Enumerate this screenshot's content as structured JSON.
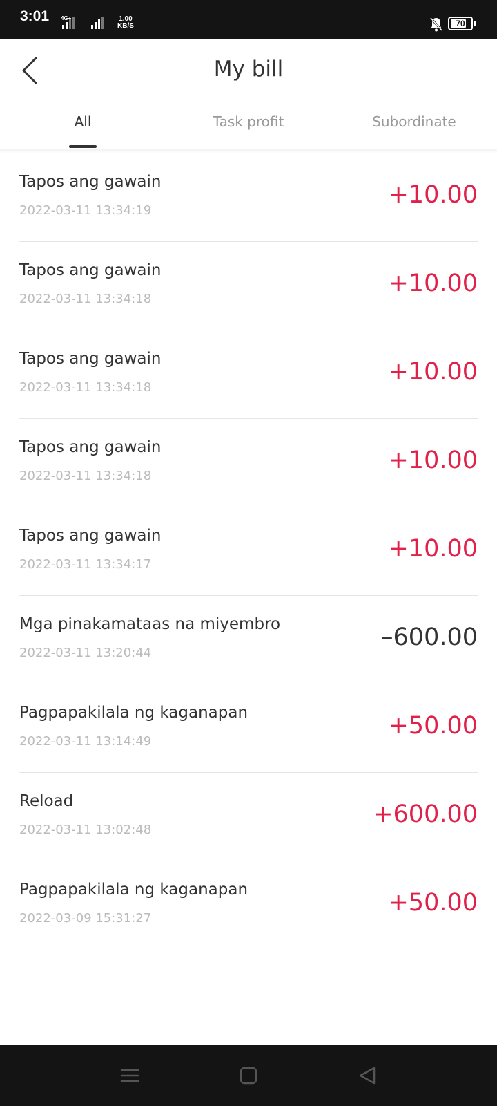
{
  "status_bar": {
    "time": "3:01",
    "network": "4G+",
    "speed_value": "1.00",
    "speed_unit": "KB/S",
    "battery": "70"
  },
  "header": {
    "title": "My bill"
  },
  "tabs": [
    {
      "label": "All",
      "active": true
    },
    {
      "label": "Task profit",
      "active": false
    },
    {
      "label": "Subordinate",
      "active": false
    }
  ],
  "bills": [
    {
      "description": "Tapos ang gawain",
      "time": "2022-03-11 13:34:19",
      "amount": "+10.00"
    },
    {
      "description": "Tapos ang gawain",
      "time": "2022-03-11 13:34:18",
      "amount": "+10.00"
    },
    {
      "description": "Tapos ang gawain",
      "time": "2022-03-11 13:34:18",
      "amount": "+10.00"
    },
    {
      "description": "Tapos ang gawain",
      "time": "2022-03-11 13:34:18",
      "amount": "+10.00"
    },
    {
      "description": "Tapos ang gawain",
      "time": "2022-03-11 13:34:17",
      "amount": "+10.00"
    },
    {
      "description": "Mga pinakamataas na miyembro",
      "time": "2022-03-11 13:20:44",
      "amount": "–600.00"
    },
    {
      "description": "Pagpapakilala ng kaganapan",
      "time": "2022-03-11 13:14:49",
      "amount": "+50.00"
    },
    {
      "description": "Reload",
      "time": "2022-03-11 13:02:48",
      "amount": "+600.00"
    },
    {
      "description": "Pagpapakilala ng kaganapan",
      "time": "2022-03-09 15:31:27",
      "amount": "+50.00"
    }
  ],
  "colors": {
    "positive_amount": "#e0224b",
    "negative_amount": "#333333",
    "status_bar_bg": "#141414"
  },
  "icons": {
    "back": "chevron-left-icon",
    "bell_muted": "bell-off-icon",
    "nav_menu": "menu-icon",
    "nav_home": "square-icon",
    "nav_back": "triangle-left-icon"
  }
}
